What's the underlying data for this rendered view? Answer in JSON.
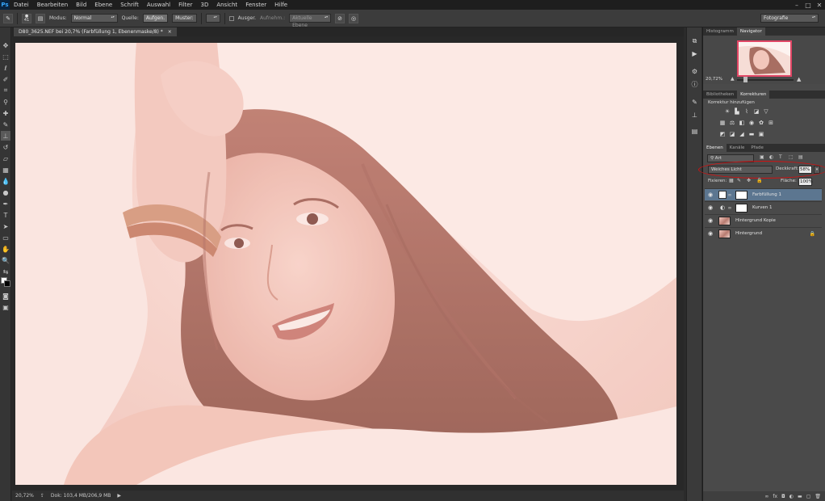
{
  "app": {
    "logo": "Ps"
  },
  "menu": [
    "Datei",
    "Bearbeiten",
    "Bild",
    "Ebene",
    "Schrift",
    "Auswahl",
    "Filter",
    "3D",
    "Ansicht",
    "Fenster",
    "Hilfe"
  ],
  "window_controls": [
    "–",
    "□",
    "✕"
  ],
  "options": {
    "brush_size": "41",
    "mode_label": "Modus:",
    "mode_value": "Normal",
    "source_label": "Quelle:",
    "source_aufgen": "Aufgen.",
    "source_muster": "Muster:",
    "ausger_label": "Ausger.",
    "aufnehm_label": "Aufnehm.:",
    "aufnehm_value": "Aktuelle Ebene",
    "workspace": "Fotografie"
  },
  "document": {
    "tab_title": "D80_3625.NEF bei 20,7% (Farbfüllung 1, Ebenenmaske/8) *",
    "tab_close": "×",
    "zoom": "20,72%",
    "doc_info": "Dok: 103,4 MB/206,9 MB"
  },
  "navigator": {
    "tabs": [
      "Histogramm",
      "Navigator"
    ],
    "active_tab": 1,
    "zoom": "20,72%"
  },
  "korrekturen": {
    "tabs": [
      "Bibliotheken",
      "Korrekturen"
    ],
    "title": "Korrektur hinzufügen"
  },
  "layers_panel": {
    "tabs": [
      "Ebenen",
      "Kanäle",
      "Pfade"
    ],
    "filter_value": "Art",
    "blend_mode": "Weiches Licht",
    "opacity_label": "Deckkraft:",
    "opacity_value": "58%",
    "fix_label": "Fixieren:",
    "fill_label": "Fläche:",
    "fill_value": "100%",
    "layers": [
      {
        "name": "Farbfüllung 1",
        "selected": true
      },
      {
        "name": "Kurven 1",
        "selected": false
      },
      {
        "name": "Hintergrund Kopie",
        "selected": false
      },
      {
        "name": "Hintergrund",
        "selected": false
      }
    ]
  },
  "colors": {
    "highlight": "#5c7690",
    "annotation": "#d41010",
    "navigator_frame": "#e14766"
  }
}
